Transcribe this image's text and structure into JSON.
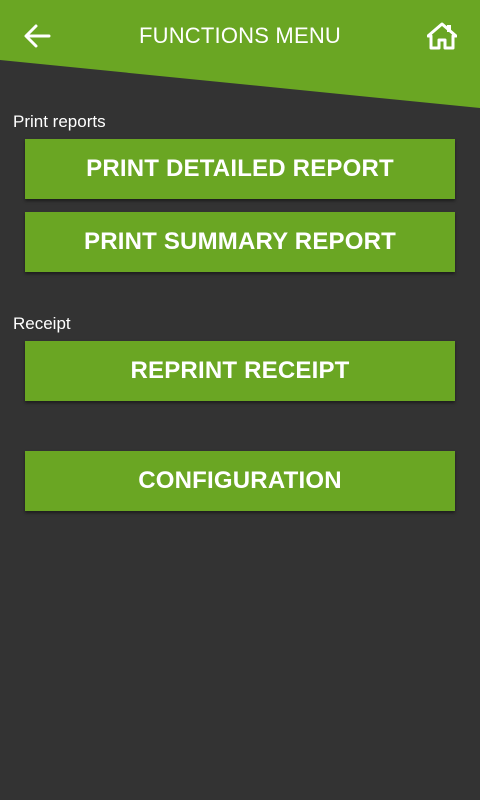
{
  "header": {
    "title": "FUNCTIONS MENU",
    "back_icon": "arrow-left-icon",
    "home_icon": "home-icon"
  },
  "sections": {
    "print_reports": {
      "label": "Print reports",
      "buttons": {
        "detailed": "PRINT DETAILED REPORT",
        "summary": "PRINT SUMMARY REPORT"
      }
    },
    "receipt": {
      "label": "Receipt",
      "buttons": {
        "reprint": "REPRINT RECEIPT"
      }
    },
    "configuration": {
      "button": "CONFIGURATION"
    }
  },
  "colors": {
    "accent": "#6aa623",
    "background": "#333333",
    "text": "#ffffff"
  }
}
